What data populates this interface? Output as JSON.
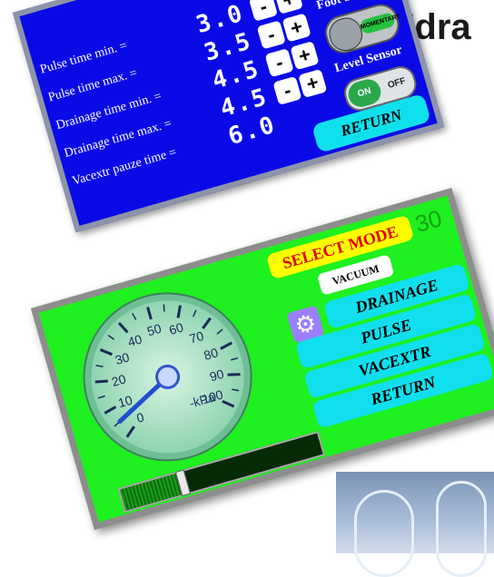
{
  "heading": "Zdra",
  "settings_screen": {
    "rows": [
      {
        "label": "Pulse time min. =",
        "value": "3.0"
      },
      {
        "label": "Pulse time max. =",
        "value": "3.5"
      },
      {
        "label": "Drainage time min. =",
        "value": "4.5"
      },
      {
        "label": "Drainage time max. =",
        "value": "4.5"
      },
      {
        "label": "Vacextr pauze time =",
        "value": "6.0"
      }
    ],
    "minus_label": "-",
    "plus_label": "+",
    "foot_switch_label": "Foot Switch",
    "foot_switch_state": "MOMENTARY",
    "level_sensor_label": "Level Sensor",
    "level_on": "ON",
    "level_off": "OFF",
    "return_label": "RETURN",
    "wrench_icon": "wrench-screwdriver-icon",
    "bg_color": "#0a0ae6"
  },
  "mode_screen": {
    "select_mode_label": "SELECT MODE",
    "counter": "30",
    "current_mode": "VACUUM",
    "gear_icon": "gear-icon",
    "modes": [
      "DRAINAGE",
      "PULSE",
      "VACEXTR",
      "RETURN"
    ],
    "gauge": {
      "unit": "-kPa",
      "ticks": [
        "0",
        "10",
        "20",
        "30",
        "40",
        "50",
        "60",
        "70",
        "80",
        "90",
        "100"
      ],
      "min": 0,
      "max": 100,
      "needle_value": 5
    },
    "progress_fraction": 0.3,
    "bg_color": "#1ff01f"
  }
}
